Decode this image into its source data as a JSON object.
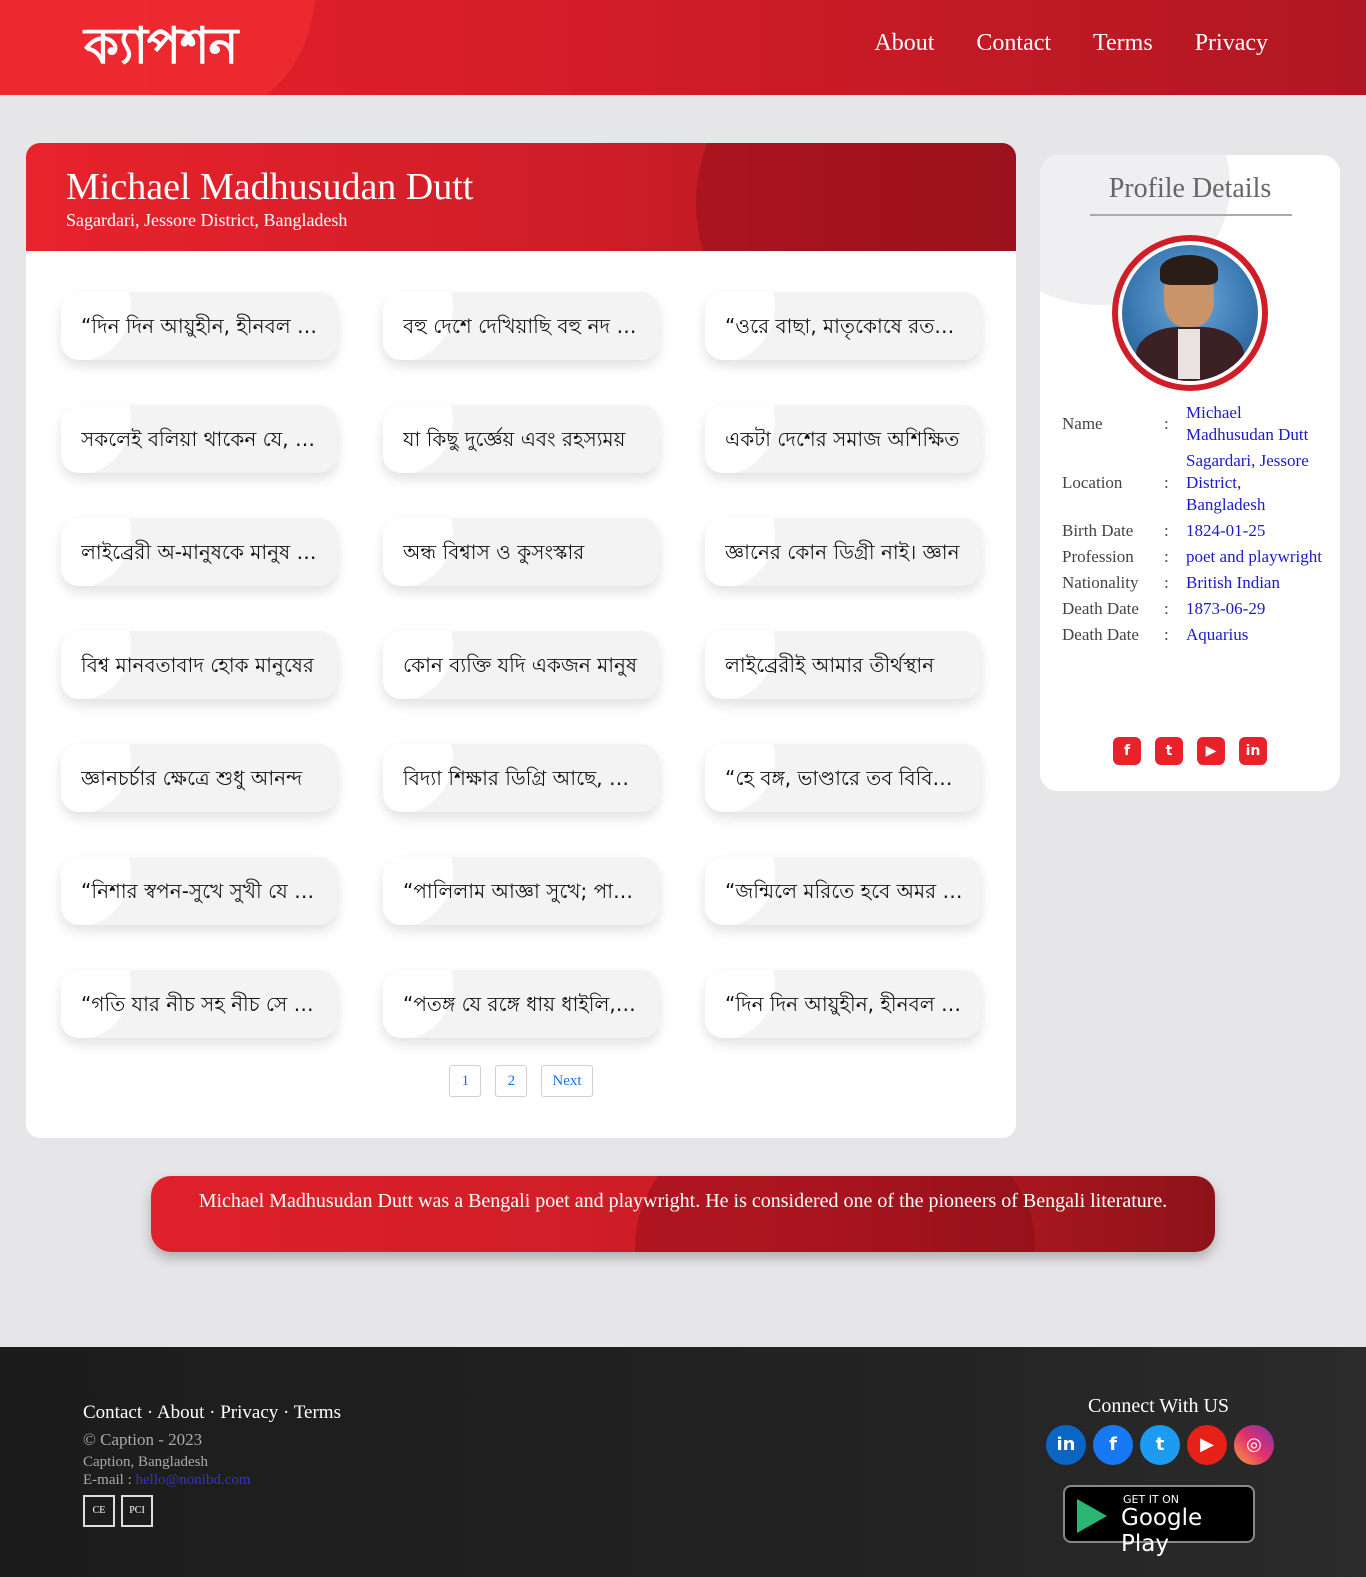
{
  "header": {
    "logo_text": "ক্যাপশন",
    "nav": [
      "About",
      "Contact",
      "Terms",
      "Privacy"
    ],
    "brand_color": "#e8212b"
  },
  "author": {
    "name": "Michael Madhusudan Dutt",
    "location": "Sagardari, Jessore District, Bangladesh"
  },
  "quotes": [
    "“দিন দিন আয়ুহীন, হীনবল দিন দিন",
    "বহু দেশে দেখিয়াছি বহু নদ দলে",
    "“ওরে বাছা, মাতৃকোষে রতনের রাজি",
    "সকলেই বলিয়া থাকেন যে, কাব্য",
    "যা কিছু দুর্জ্ঞেয় এবং রহস্যময়",
    "একটা দেশের সমাজ অশিক্ষিত",
    "লাইব্রেরী অ-মানুষকে মানুষ করে",
    "অন্ধ বিশ্বাস ও কুসংস্কার",
    "জ্ঞানের কোন ডিগ্রী নাই। জ্ঞান",
    "বিশ্ব মানবতাবাদ হোক মানুষের",
    "কোন ব্যক্তি যদি একজন মানুষ",
    "লাইব্রেরীই আমার তীর্থস্থান",
    "জ্ঞানচর্চার ক্ষেত্রে শুধু আনন্দ",
    "বিদ্যা শিক্ষার ডিগ্রি আছে, জ্ঞানের",
    "“হে বঙ্গ, ভাণ্ডারে তব বিবিধ রতন",
    "“নিশার স্বপন-সুখে সুখী যে কি সুখ",
    "“পালিলাম আজ্ঞা সুখে; পাইলাম",
    "“জন্মিলে মরিতে হবে অমর কে কোথা",
    "“গতি যার নীচ সহ নীচ সে দুর্মতি",
    "“পতঙ্গ যে রঙ্গে ধায় ধাইলি, অবোধ",
    "“দিন দিন আয়ুহীন, হীনবল দিন দিন"
  ],
  "pagination": [
    "1",
    "2",
    "Next"
  ],
  "profile": {
    "title": "Profile Details",
    "rows": [
      {
        "label": "Name",
        "value": "Michael Madhusudan Dutt"
      },
      {
        "label": "Location",
        "value": "Sagardari, Jessore District, Bangladesh"
      },
      {
        "label": "Birth Date",
        "value": "1824-01-25"
      },
      {
        "label": "Profession",
        "value": "poet and playwright"
      },
      {
        "label": "Nationality",
        "value": "British Indian"
      },
      {
        "label": "Death Date",
        "value": "1873-06-29"
      },
      {
        "label": "Death Date",
        "value": "Aquarius"
      }
    ],
    "separator": ":",
    "social_icons": [
      "facebook-icon",
      "twitter-icon",
      "youtube-icon",
      "linkedin-icon"
    ]
  },
  "bio": "Michael Madhusudan Dutt was a Bengali poet and playwright. He is considered one of the pioneers of Bengali literature.",
  "footer": {
    "links": [
      "Contact",
      "About",
      "Privacy",
      "Terms"
    ],
    "copyright": "© Caption - 2023",
    "address": "Caption, Bangladesh",
    "email_label": "E-mail : ",
    "email": "hello@nonibd.com",
    "badges": [
      "CE",
      "PCI"
    ],
    "connect_title": "Connect With US",
    "connect_icons": [
      "linkedin-icon",
      "facebook-icon",
      "twitter-icon",
      "youtube-icon",
      "instagram-icon"
    ],
    "store_small": "GET IT ON",
    "store_big": "Google Play"
  }
}
